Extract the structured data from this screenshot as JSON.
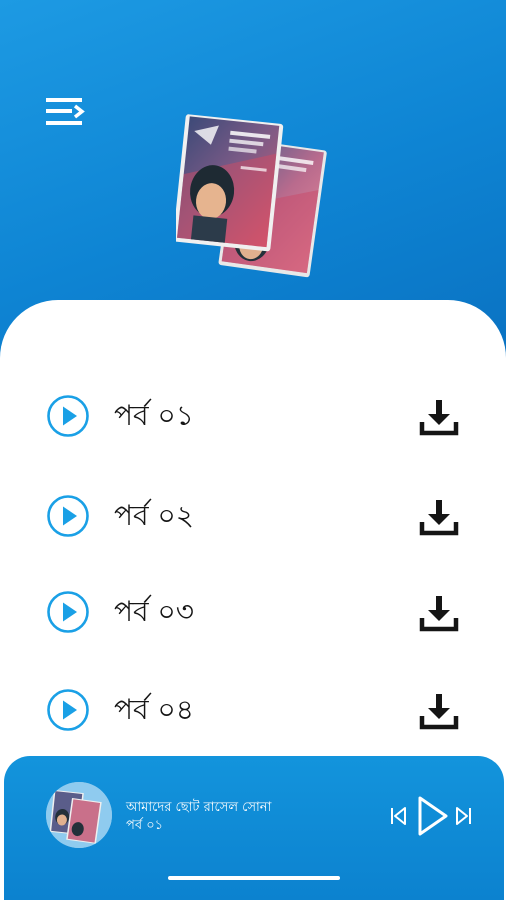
{
  "header": {
    "menu_icon": "menu-icon",
    "cover_icon": "book-cover-art"
  },
  "episodes": [
    {
      "label": "পর্ব ০১",
      "play_icon": "play-icon",
      "download_icon": "download-icon"
    },
    {
      "label": "পর্ব ০২",
      "play_icon": "play-icon",
      "download_icon": "download-icon"
    },
    {
      "label": "পর্ব ০৩",
      "play_icon": "play-icon",
      "download_icon": "download-icon"
    },
    {
      "label": "পর্ব ০৪",
      "play_icon": "play-icon",
      "download_icon": "download-icon"
    }
  ],
  "player": {
    "title": "আমাদের ছোট রাসেল সোনা",
    "subtitle": "পর্ব ০১",
    "controls": [
      "skip-previous-icon",
      "play-icon",
      "skip-next-icon"
    ]
  },
  "colors": {
    "primary": "#0e84d3",
    "accent": "#1aa0e6",
    "text": "#151515",
    "surface": "#ffffff"
  }
}
